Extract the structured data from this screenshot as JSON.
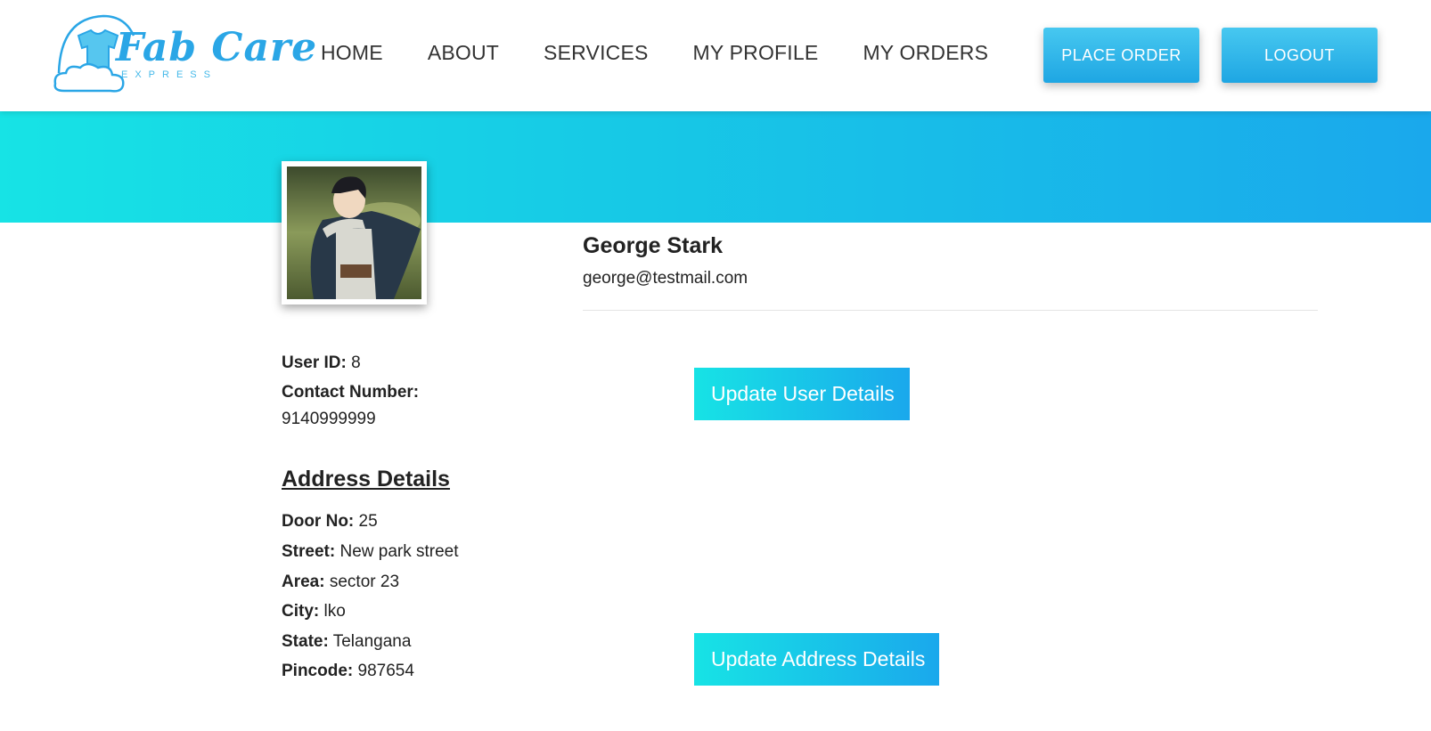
{
  "brand": {
    "name": "Fab Care",
    "tagline": "EXPRESS"
  },
  "nav": {
    "links": [
      "HOME",
      "ABOUT",
      "SERVICES",
      "MY PROFILE",
      "MY ORDERS"
    ],
    "place_order": "PLACE ORDER",
    "logout": "LOGOUT"
  },
  "profile": {
    "name": "George Stark",
    "email": "george@testmail.com",
    "user_id_label": "User ID:",
    "user_id": "8",
    "contact_label": "Contact Number:",
    "contact": "9140999999"
  },
  "address": {
    "heading": "Address Details",
    "door_label": "Door No:",
    "door": "25",
    "street_label": "Street:",
    "street": "New park street",
    "area_label": "Area:",
    "area": "sector 23",
    "city_label": "City:",
    "city": "lko",
    "state_label": "State:",
    "state": "Telangana",
    "pincode_label": "Pincode:",
    "pincode": "987654"
  },
  "actions": {
    "update_user": "Update User Details",
    "update_address": "Update Address Details"
  },
  "colors": {
    "accent_start": "#17e3e5",
    "accent_end": "#1aa8ec"
  }
}
